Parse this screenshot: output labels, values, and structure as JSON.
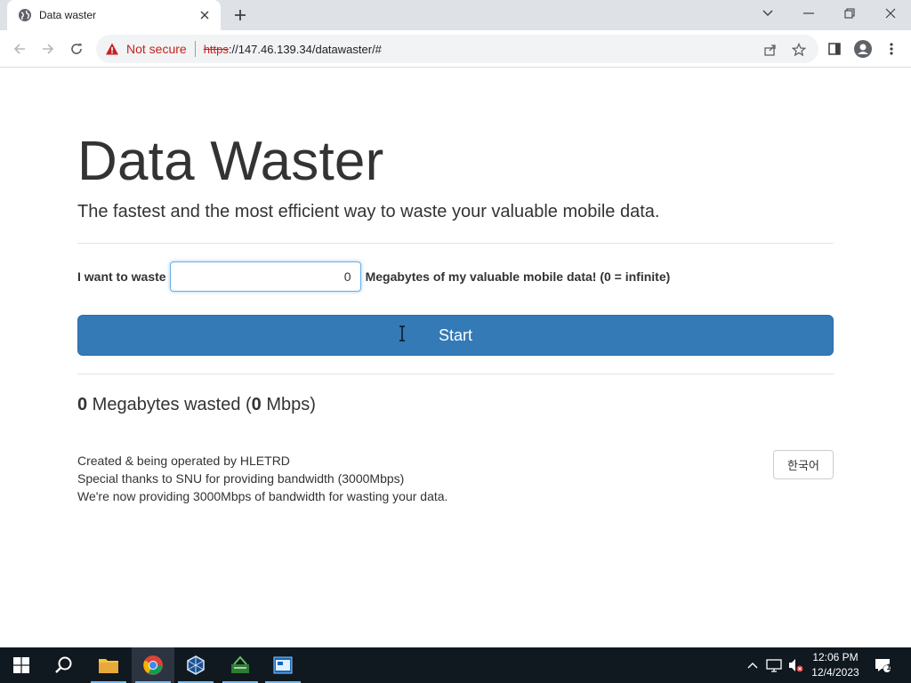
{
  "browser": {
    "tab": {
      "title": "Data waster",
      "favicon": "globe-icon"
    },
    "address": {
      "security_label": "Not secure",
      "url_scheme": "https",
      "url_rest": "://147.46.139.34/datawaster/#"
    }
  },
  "page": {
    "title": "Data Waster",
    "subtitle": "The fastest and the most efficient way to waste your valuable mobile data.",
    "form": {
      "label_before": "I want to waste",
      "input_value": "0",
      "label_after": "Megabytes of my valuable mobile data! (0 = infinite)"
    },
    "start_label": "Start",
    "stats": {
      "wasted_value": "0",
      "wasted_unit": " Megabytes wasted (",
      "speed_value": "0",
      "speed_unit": " Mbps)"
    },
    "credits": {
      "line1": "Created & being operated by HLETRD",
      "line2": "Special thanks to SNU for providing bandwidth (3000Mbps)",
      "line3": "We're now providing 3000Mbps of bandwidth for wasting your data."
    },
    "lang_button": "한국어"
  },
  "taskbar": {
    "time": "12:06 PM",
    "date": "12/4/2023",
    "notification_count": "1"
  },
  "colors": {
    "accent": "#337ab7",
    "danger": "#c5221f",
    "taskbar": "#101820"
  }
}
